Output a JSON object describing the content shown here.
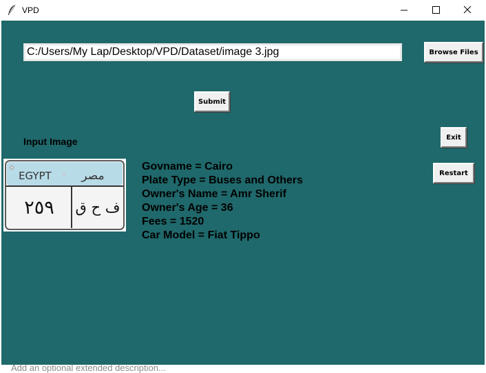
{
  "window": {
    "title": "VPD",
    "app_icon": "feather-icon",
    "controls": [
      "minimize-icon",
      "maximize-icon",
      "close-icon"
    ]
  },
  "file_path": {
    "value": "C:/Users/My Lap/Desktop/VPD/Dataset/image 3.jpg"
  },
  "buttons": {
    "browse": "Browse Files",
    "submit": "Submit",
    "exit": "Exit",
    "restart": "Restart"
  },
  "input_image": {
    "label": "Input Image",
    "plate_country_en": "EGYPT",
    "plate_country_ar": "مصر",
    "plate_number": "٢٥٩",
    "plate_letters": "ف ح ق"
  },
  "results": [
    "Govname = Cairo",
    "Plate Type = Buses and Others",
    "Owner's Name = Amr Sherif",
    "Owner's Age = 36",
    "Fees = 1520",
    "Car Model = Fiat Tippo"
  ],
  "background_hint": "Add an optional extended description...",
  "colors": {
    "client_background": "#1f686b",
    "plate_header": "#b8dbe8"
  }
}
